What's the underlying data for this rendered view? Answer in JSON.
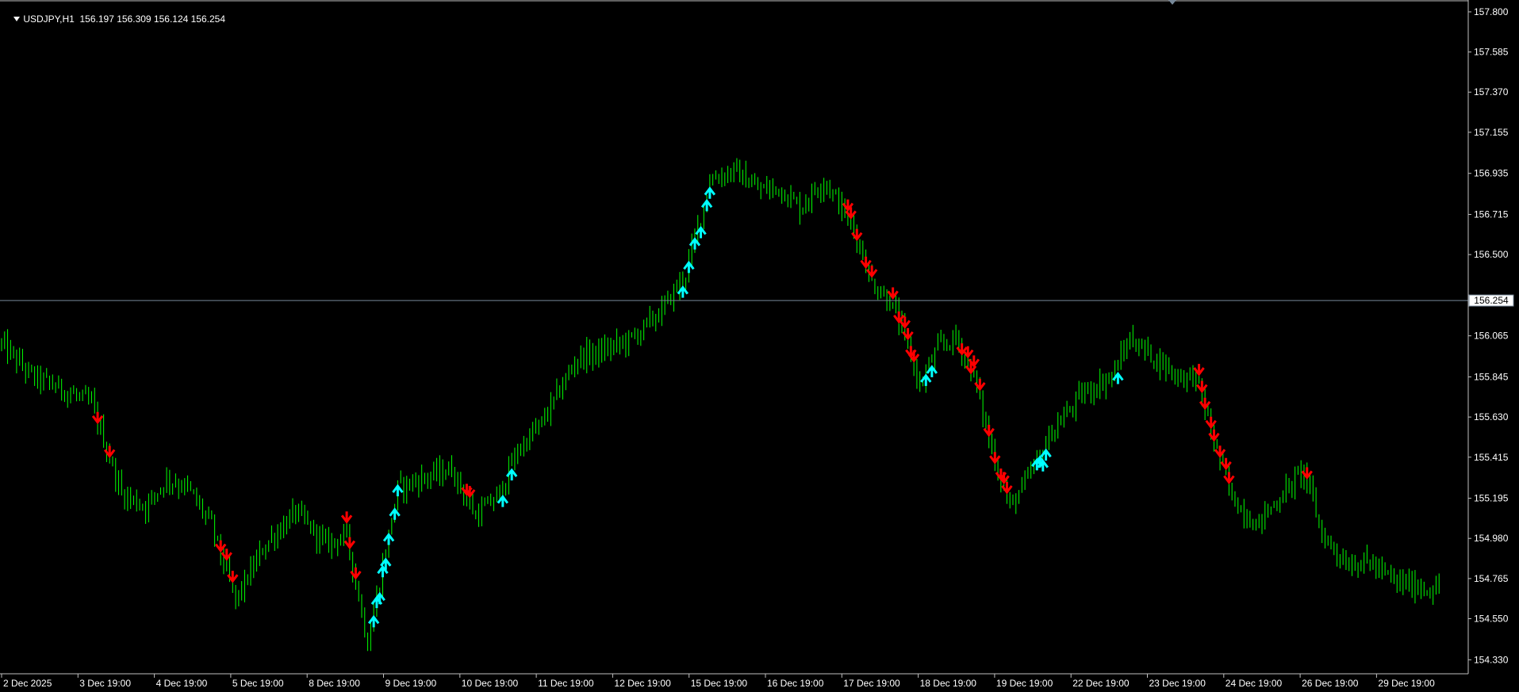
{
  "window": {
    "symbol_timeframe": "USDJPY,H1",
    "ohlc": "156.197 156.309 156.124 156.254"
  },
  "colors": {
    "background": "#000000",
    "candle": "#00ff00",
    "up_arrow": "#00ffff",
    "down_arrow": "#ff0000",
    "price_line": "#778899",
    "axis_text": "#ffffff"
  },
  "chart_data": {
    "type": "candlestick",
    "symbol": "USDJPY",
    "timeframe": "H1",
    "current_price": 156.254,
    "ylim": [
      154.255,
      157.855
    ],
    "y_ticks": [
      "157.800",
      "157.585",
      "157.370",
      "157.155",
      "156.935",
      "156.715",
      "156.500",
      "156.065",
      "155.845",
      "155.630",
      "155.415",
      "155.195",
      "154.980",
      "154.765",
      "154.550",
      "154.330"
    ],
    "x_ticks": [
      "2 Dec 2025",
      "3 Dec 19:00",
      "4 Dec 19:00",
      "5 Dec 19:00",
      "8 Dec 19:00",
      "9 Dec 19:00",
      "10 Dec 19:00",
      "11 Dec 19:00",
      "12 Dec 19:00",
      "15 Dec 19:00",
      "16 Dec 19:00",
      "17 Dec 19:00",
      "18 Dec 19:00",
      "19 Dec 19:00",
      "22 Dec 19:00",
      "23 Dec 19:00",
      "24 Dec 19:00",
      "26 Dec 19:00",
      "29 Dec 19:00"
    ],
    "bar_count": 480,
    "price_path": [
      [
        0,
        156.02
      ],
      [
        10,
        155.85
      ],
      [
        20,
        155.78
      ],
      [
        30,
        155.7
      ],
      [
        40,
        155.22
      ],
      [
        48,
        155.15
      ],
      [
        55,
        155.3
      ],
      [
        62,
        155.25
      ],
      [
        70,
        155.05
      ],
      [
        78,
        154.65
      ],
      [
        88,
        154.95
      ],
      [
        98,
        155.12
      ],
      [
        108,
        154.95
      ],
      [
        115,
        155.0
      ],
      [
        122,
        154.42
      ],
      [
        132,
        155.25
      ],
      [
        140,
        155.3
      ],
      [
        150,
        155.35
      ],
      [
        158,
        155.1
      ],
      [
        165,
        155.2
      ],
      [
        172,
        155.45
      ],
      [
        180,
        155.6
      ],
      [
        192,
        155.95
      ],
      [
        200,
        155.98
      ],
      [
        210,
        156.05
      ],
      [
        220,
        156.2
      ],
      [
        228,
        156.4
      ],
      [
        236,
        156.9
      ],
      [
        244,
        156.95
      ],
      [
        252,
        156.85
      ],
      [
        260,
        156.85
      ],
      [
        266,
        156.75
      ],
      [
        274,
        156.9
      ],
      [
        280,
        156.75
      ],
      [
        285,
        156.6
      ],
      [
        290,
        156.35
      ],
      [
        296,
        156.25
      ],
      [
        300,
        156.1
      ],
      [
        306,
        155.8
      ],
      [
        312,
        156.0
      ],
      [
        318,
        156.05
      ],
      [
        324,
        155.85
      ],
      [
        330,
        155.45
      ],
      [
        336,
        155.15
      ],
      [
        342,
        155.3
      ],
      [
        350,
        155.55
      ],
      [
        360,
        155.75
      ],
      [
        370,
        155.85
      ],
      [
        376,
        156.05
      ],
      [
        384,
        155.95
      ],
      [
        392,
        155.85
      ],
      [
        398,
        155.85
      ],
      [
        404,
        155.5
      ],
      [
        410,
        155.2
      ],
      [
        418,
        155.05
      ],
      [
        426,
        155.2
      ],
      [
        434,
        155.35
      ],
      [
        440,
        155.0
      ],
      [
        448,
        154.85
      ],
      [
        456,
        154.85
      ],
      [
        464,
        154.75
      ],
      [
        472,
        154.72
      ],
      [
        480,
        154.7
      ]
    ],
    "up_arrows_count": 52,
    "down_arrows_count": 40
  }
}
